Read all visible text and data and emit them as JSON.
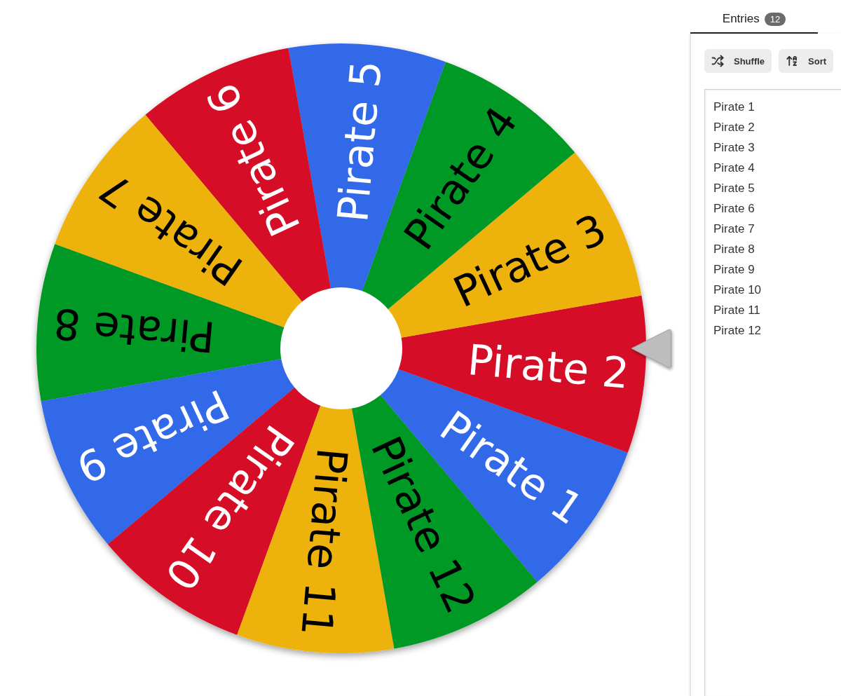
{
  "wheel": {
    "segments": [
      {
        "label": "Pirate 1",
        "color": "#3369e8",
        "kind": "light"
      },
      {
        "label": "Pirate 2",
        "color": "#d50f25",
        "kind": "light"
      },
      {
        "label": "Pirate 3",
        "color": "#eeb211",
        "kind": "dark"
      },
      {
        "label": "Pirate 4",
        "color": "#009925",
        "kind": "dark"
      },
      {
        "label": "Pirate 5",
        "color": "#3369e8",
        "kind": "light"
      },
      {
        "label": "Pirate 6",
        "color": "#d50f25",
        "kind": "light"
      },
      {
        "label": "Pirate 7",
        "color": "#eeb211",
        "kind": "dark"
      },
      {
        "label": "Pirate 8",
        "color": "#009925",
        "kind": "dark"
      },
      {
        "label": "Pirate 9",
        "color": "#3369e8",
        "kind": "light"
      },
      {
        "label": "Pirate 10",
        "color": "#d50f25",
        "kind": "light"
      },
      {
        "label": "Pirate 11",
        "color": "#eeb211",
        "kind": "dark"
      },
      {
        "label": "Pirate 12",
        "color": "#009925",
        "kind": "dark"
      }
    ]
  },
  "panel": {
    "tabs": [
      {
        "label": "Entries",
        "count": "12",
        "selected": true
      }
    ],
    "buttons": [
      {
        "label": "Shuffle",
        "kind": "shuffle"
      },
      {
        "label": "Sort",
        "kind": "sort"
      }
    ],
    "entries": [
      "Pirate 1",
      "Pirate 2",
      "Pirate 3",
      "Pirate 4",
      "Pirate 5",
      "Pirate 6",
      "Pirate 7",
      "Pirate 8",
      "Pirate 9",
      "Pirate 10",
      "Pirate 11",
      "Pirate 12"
    ]
  }
}
